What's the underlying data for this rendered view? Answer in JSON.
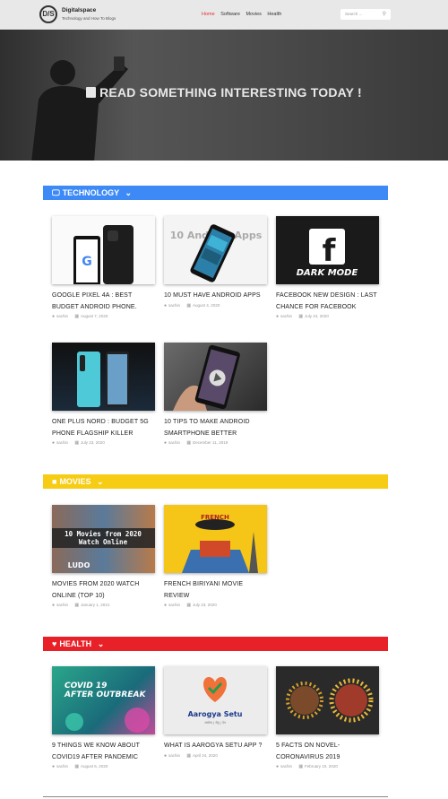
{
  "header": {
    "logo_text": "D/S",
    "brand": "Digitalspace",
    "tagline": "Technology and How To Blogs",
    "nav": [
      "Home",
      "Software",
      "Movies",
      "Health"
    ],
    "search_placeholder": "Search ..."
  },
  "hero": {
    "title": "READ SOMETHING INTERESTING TODAY !"
  },
  "sections": [
    {
      "name": "TECHNOLOGY",
      "color": "#3d8af7",
      "posts": [
        {
          "title": "GOOGLE PIXEL 4A : BEST BUDGET ANDROID PHONE.",
          "author": "sachin",
          "date": "August 7, 2020"
        },
        {
          "title": "10 MUST HAVE ANDROID APPS",
          "author": "sachin",
          "date": "August 4, 2020",
          "thumb_text": "10 Android Apps"
        },
        {
          "title": "FACEBOOK NEW DESIGN : LAST CHANCE FOR FACEBOOK",
          "author": "sachin",
          "date": "July 24, 2020",
          "thumb_text": "DARK MODE"
        },
        {
          "title": "ONE PLUS NORD : BUDGET 5G PHONE FLAGSHIP KILLER",
          "author": "sachin",
          "date": "July 23, 2020"
        },
        {
          "title": "10 TIPS TO MAKE ANDROID SMARTPHONE BETTER",
          "author": "sachin",
          "date": "December 11, 2019"
        }
      ]
    },
    {
      "name": "MOVIES",
      "color": "#f7cc14",
      "posts": [
        {
          "title": "MOVIES FROM 2020 WATCH ONLINE (TOP 10)",
          "author": "sachin",
          "date": "January 1, 2021",
          "thumb_text": "10 Movies from 2020 Watch Online"
        },
        {
          "title": "FRENCH BIRIYANI MOVIE REVIEW",
          "author": "sachin",
          "date": "July 23, 2020",
          "thumb_text": "FRENCH BIRIYANI"
        }
      ]
    },
    {
      "name": "HEALTH",
      "color": "#e82128",
      "posts": [
        {
          "title": "9 THINGS WE KNOW ABOUT COVID19 AFTER PANDEMIC",
          "author": "sachin",
          "date": "August 6, 2020",
          "thumb_text": "COVID 19 AFTER OUTBREAK"
        },
        {
          "title": "WHAT IS AAROGYA SETU APP ?",
          "author": "sachin",
          "date": "April 24, 2020",
          "thumb_text": "Aarogya Setu"
        },
        {
          "title": "5 FACTS ON NOVEL-CORONAVIRUS 2019",
          "author": "sachin",
          "date": "February 10, 2020"
        }
      ]
    }
  ]
}
